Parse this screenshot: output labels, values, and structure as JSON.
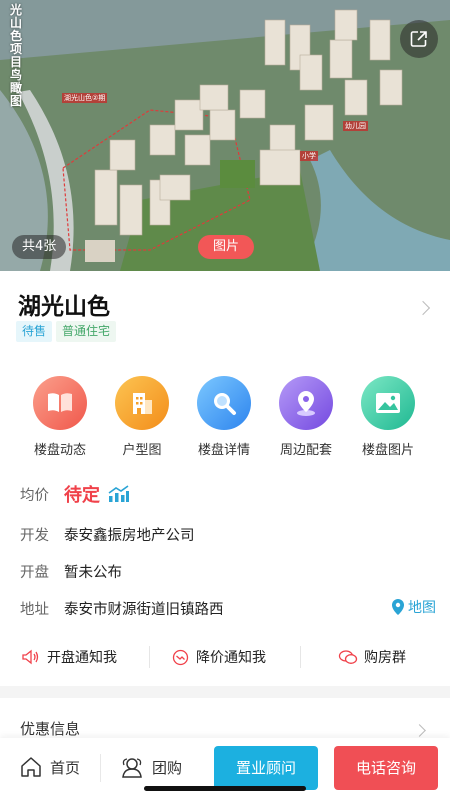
{
  "hero": {
    "vertical_title": "光山色项目鸟瞰图",
    "count_label": "共4张",
    "type_label": "图片",
    "map_labels": [
      "湖光山色②期",
      "幼儿园",
      "小学"
    ]
  },
  "project": {
    "name": "湖光山色",
    "tags": [
      "待售",
      "普通住宅"
    ]
  },
  "quick_menu": [
    {
      "label": "楼盘动态",
      "icon": "book-icon",
      "color": "#f36f5e"
    },
    {
      "label": "户型图",
      "icon": "building-icon",
      "color": "#f7a224"
    },
    {
      "label": "楼盘详情",
      "icon": "magnifier-icon",
      "color": "#3ba2f2"
    },
    {
      "label": "周边配套",
      "icon": "location-pin-icon",
      "color": "#8b63e8"
    },
    {
      "label": "楼盘图片",
      "icon": "picture-icon",
      "color": "#2fc7a4"
    }
  ],
  "info": {
    "price_key": "均价",
    "price_val": "待定",
    "dev_key": "开发",
    "dev_val": "泰安鑫振房地产公司",
    "open_key": "开盘",
    "open_val": "暂未公布",
    "addr_key": "地址",
    "addr_val": "泰安市财源街道旧镇路西",
    "map_link": "地图"
  },
  "notify": [
    "开盘通知我",
    "降价通知我",
    "购房群"
  ],
  "promo": "优惠信息",
  "bottom": {
    "home": "首页",
    "group": "团购",
    "advisor": "置业顾问",
    "call": "电话咨询"
  },
  "colors": {
    "accent_blue": "#1cb0e0",
    "accent_red": "#f04f55",
    "price_red": "#f0414a"
  }
}
